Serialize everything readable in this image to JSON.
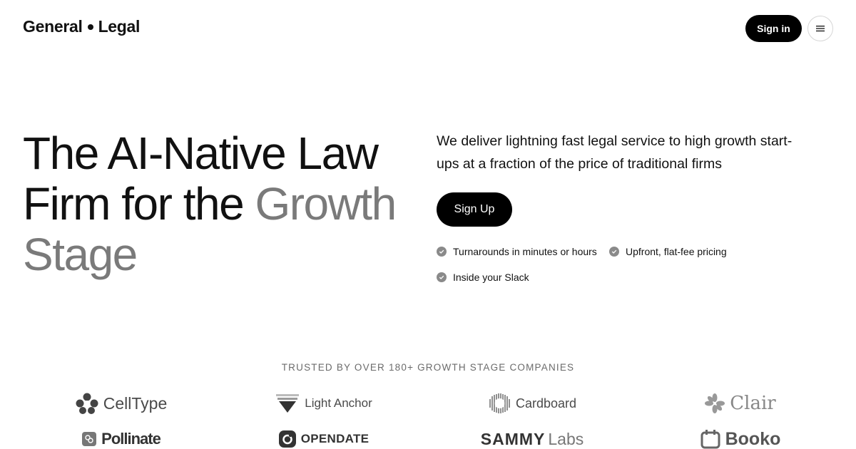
{
  "header": {
    "logo_left": "General",
    "logo_right": "Legal",
    "signin_label": "Sign in",
    "menu_icon": "hamburger-icon"
  },
  "hero": {
    "title_line1": "The AI-Native Law",
    "title_line2a": "Firm for the ",
    "title_line2b": "Growth",
    "title_line3": "Stage",
    "description": "We deliver lightning fast legal service to high growth start-ups at a fraction of the price of traditional firms",
    "signup_label": "Sign Up",
    "features": [
      "Turnarounds in minutes or hours",
      "Upfront, flat-fee pricing",
      "Inside your Slack"
    ]
  },
  "trusted": {
    "heading": "TRUSTED BY OVER 180+ GROWTH STAGE COMPANIES",
    "logos": [
      {
        "name": "CellType",
        "icon": "celltype-logo-icon"
      },
      {
        "name": "Light Anchor",
        "icon": "light-anchor-logo-icon"
      },
      {
        "name": "Cardboard",
        "icon": "cardboard-logo-icon"
      },
      {
        "name": "Clair",
        "icon": "clair-logo-icon"
      },
      {
        "name": "Pollinate",
        "icon": "pollinate-logo-icon"
      },
      {
        "name": "OPENDATE",
        "icon": "opendate-logo-icon"
      },
      {
        "name": "SAMMY",
        "suffix": "Labs"
      },
      {
        "name": "Booko",
        "icon": "booko-logo-icon"
      }
    ]
  },
  "colors": {
    "primary": "#000000",
    "muted_text": "#7a7a7a",
    "check_icon": "#8a8a8a",
    "logo_gray": "#4a4a4a"
  }
}
